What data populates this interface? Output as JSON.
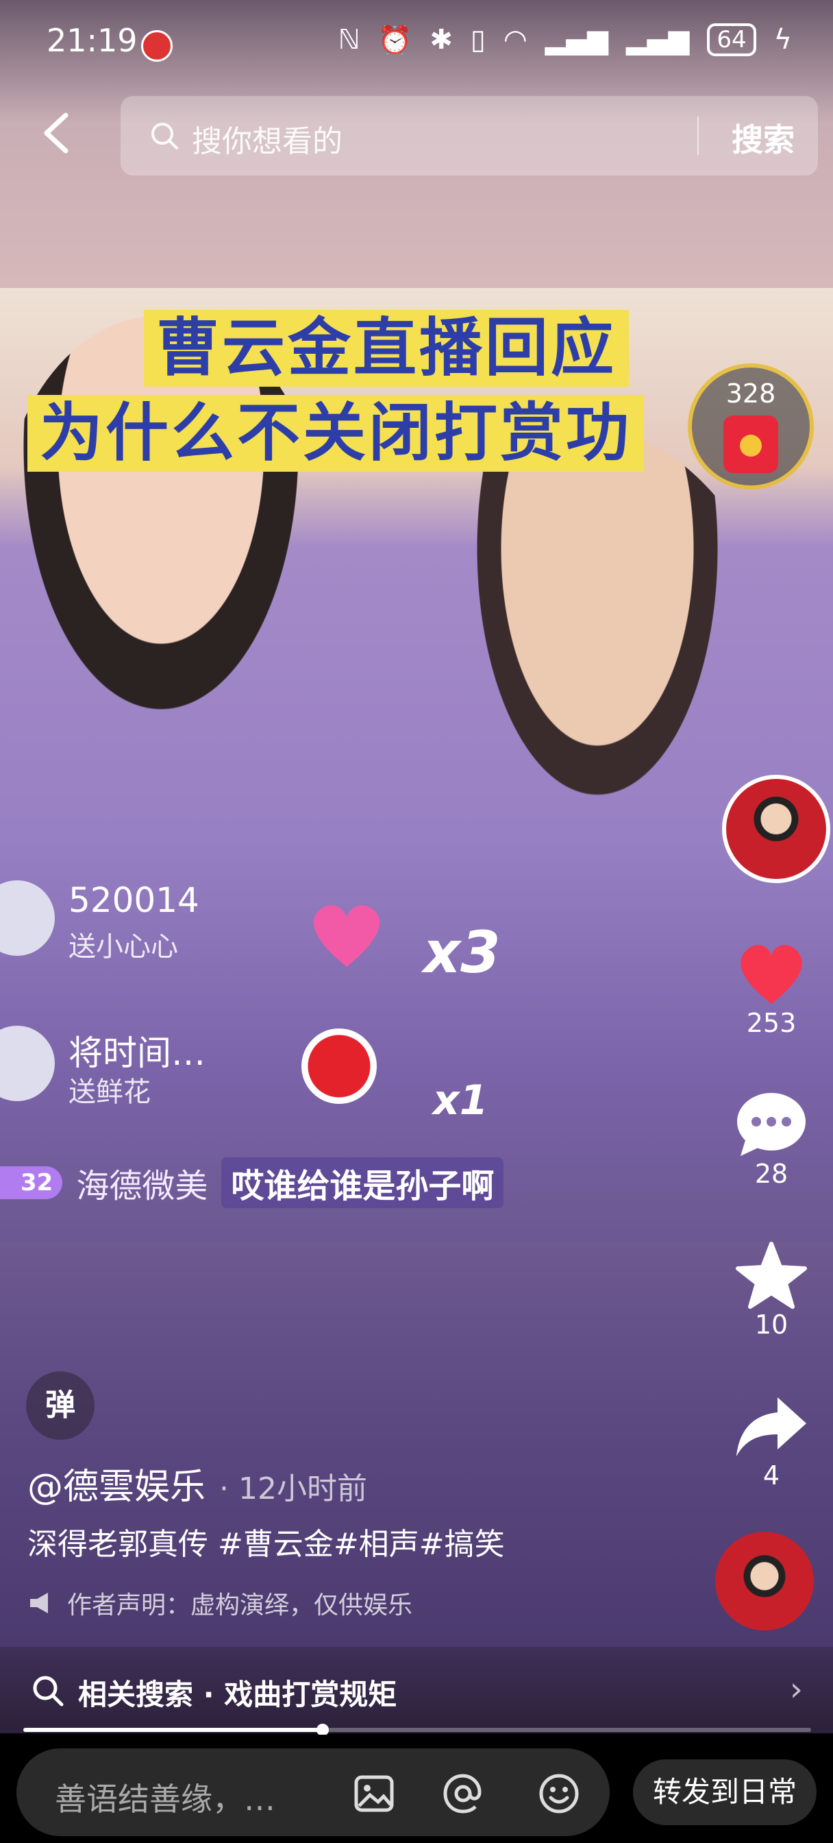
{
  "status_bar": {
    "time": "21:19",
    "battery": "64"
  },
  "search": {
    "placeholder": "搜你想看的",
    "button": "搜索"
  },
  "video": {
    "title_line1": "曹云金直播回应",
    "title_line2": "为什么不关闭打赏功",
    "redpacket_count": "328",
    "gifts": [
      {
        "user": "520014",
        "action": "送小心心"
      },
      {
        "user": "将时间…",
        "action": "送鲜花"
      }
    ],
    "gift_multipliers": [
      "x3",
      "x1"
    ],
    "live_comment": {
      "level": "32",
      "user": "海德微美",
      "text": "哎谁给谁是孙子啊"
    }
  },
  "sidebar": {
    "likes": "253",
    "comments": "28",
    "favorites": "10",
    "shares": "4"
  },
  "danmu_label": "弹",
  "post": {
    "author": "@德雲娱乐",
    "time": "· 12小时前",
    "caption": "深得老郭真传 #曹云金#相声#搞笑",
    "disclaimer": "作者声明：虚构演绎，仅供娱乐"
  },
  "related_search": {
    "text": "相关搜索 · 戏曲打赏规矩"
  },
  "progress": {
    "fraction": 0.38
  },
  "bottom": {
    "input_placeholder": "善语结善缘，…",
    "share_button": "转发到日常"
  }
}
